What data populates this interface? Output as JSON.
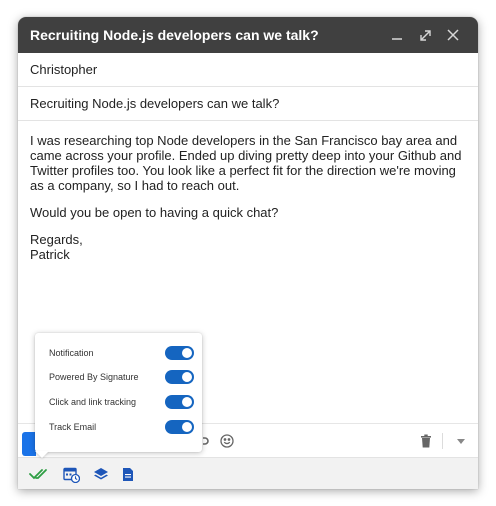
{
  "compose": {
    "title": "Recruiting Node.js developers can we talk?",
    "to": "Christopher",
    "subject": "Recruiting Node.js developers can we talk?",
    "body": {
      "paragraph1": "I was researching top Node developers in the San Francisco bay area and came across your profile. Ended up diving pretty deep into your Github and Twitter profiles too. You look like a perfect fit for the direction we're moving as a company, so I had to reach out.",
      "paragraph2": "Would you be open to having a quick chat?",
      "closing": "Regards,",
      "signature": "Patrick"
    }
  },
  "window_icons": [
    "minimize-icon",
    "expand-icon",
    "close-icon"
  ],
  "toolbar_icons": [
    "link-icon",
    "emoji-icon",
    "trash-icon",
    "more-options-icon"
  ],
  "bottom_icons": [
    "double-check-icon",
    "calendar-clock-icon",
    "layers-icon",
    "document-icon"
  ],
  "popup": {
    "options": [
      {
        "label": "Notification",
        "enabled": true
      },
      {
        "label": "Powered By Signature",
        "enabled": true
      },
      {
        "label": "Click and link tracking",
        "enabled": true
      },
      {
        "label": "Track Email",
        "enabled": true
      }
    ]
  },
  "colors": {
    "titlebar": "#404040",
    "toggle_on": "#1565c0",
    "send_blue": "#1a73e8",
    "check_green": "#2e9e44",
    "icon_blue": "#1e56b8"
  }
}
